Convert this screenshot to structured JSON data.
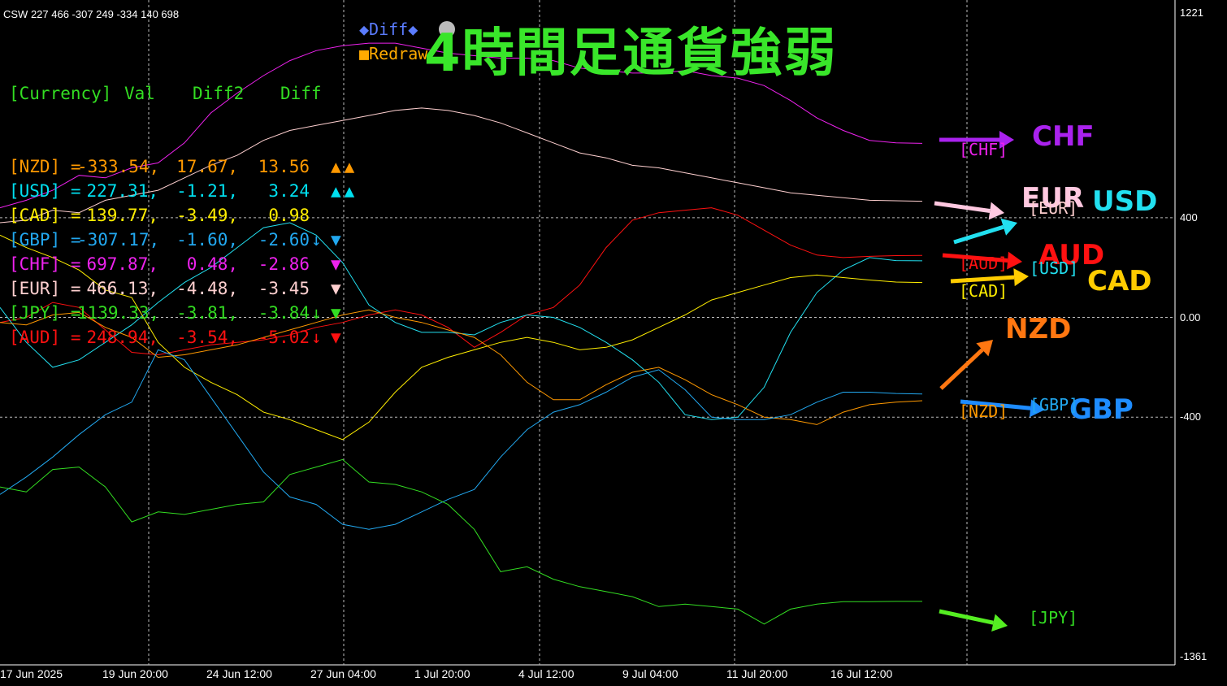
{
  "header": {
    "indicator_text": "CSW 227 466 -307 249 -334 140 698",
    "title": "4時間足通貨強弱",
    "diff_button": "◆Diff◆",
    "redraw_button": "■Redraw"
  },
  "table": {
    "headers": {
      "currency": "[Currency]",
      "val": "Val",
      "diff2": "Diff2",
      "diff": "Diff"
    },
    "rows": [
      {
        "name": "[NZD] =",
        "val": "-333.54,",
        "diff2": "17.67,",
        "diff": "13.56",
        "arrow": "",
        "marks": "▲▲",
        "color": "#ff9900"
      },
      {
        "name": "[USD] =",
        "val": "227.31,",
        "diff2": "-1.21,",
        "diff": "3.24",
        "arrow": "",
        "marks": "▲▲",
        "color": "#00e0f0"
      },
      {
        "name": "[CAD] =",
        "val": "139.77,",
        "diff2": "-3.49,",
        "diff": "0.98",
        "arrow": "",
        "marks": "",
        "color": "#ffee00"
      },
      {
        "name": "[GBP] =",
        "val": "-307.17,",
        "diff2": "-1.60,",
        "diff": "-2.60",
        "arrow": "↓",
        "marks": "▼",
        "color": "#22a8f0"
      },
      {
        "name": "[CHF] =",
        "val": "697.87,",
        "diff2": "0.48,",
        "diff": "-2.86",
        "arrow": "",
        "marks": "▼",
        "color": "#ee22ee"
      },
      {
        "name": "[EUR] =",
        "val": "466.13,",
        "diff2": "-4.48,",
        "diff": "-3.45",
        "arrow": "",
        "marks": "▼",
        "color": "#ffd0d0"
      },
      {
        "name": "[JPY] =",
        "val": "1139.33,",
        "diff2": "-3.81,",
        "diff": "-3.84",
        "arrow": "↓",
        "marks": "▼",
        "color": "#33dd22"
      },
      {
        "name": "[AUD] =",
        "val": "248.94,",
        "diff2": "-3.54,",
        "diff": "-5.02",
        "arrow": "↓",
        "marks": "▼",
        "color": "#ff1111"
      }
    ]
  },
  "labels": {
    "chf_big": "CHF",
    "eur_big": "EUR",
    "usd_big": "USD",
    "aud_big": "AUD",
    "cad_big": "CAD",
    "nzd_big": "NZD",
    "gbp_big": "GBP",
    "chf_tag": "[CHF]",
    "eur_tag": "[EUR]",
    "aud_tag": "[AUD]",
    "usd_tag": "[USD]",
    "cad_tag": "[CAD]",
    "nzd_tag": "[NZD]",
    "gbp_tag": "[GBP]",
    "jpy_tag": "[JPY]"
  },
  "colors": {
    "chf": "#aa22ee",
    "eur": "#ffc8e0",
    "usd": "#22e0f0",
    "aud": "#ff1111",
    "cad": "#ffcc00",
    "nzd": "#ff7711",
    "gbp": "#1e8cff",
    "jpy": "#55ee22",
    "title": "#39e62a"
  },
  "chart_data": {
    "type": "line",
    "ylim": [
      -1361,
      1221
    ],
    "y_ticks": [
      "1221",
      "400",
      "0.00",
      "-400",
      "-1361"
    ],
    "x_ticks": [
      "17 Jun 2025",
      "19 Jun 20:00",
      "24 Jun 12:00",
      "27 Jun 04:00",
      "1 Jul 20:00",
      "4 Jul 12:00",
      "9 Jul 04:00",
      "11 Jul 20:00",
      "16 Jul 12:00"
    ],
    "grid": true,
    "x": [
      0,
      1,
      2,
      3,
      4,
      5,
      6,
      7,
      8,
      9,
      10,
      11,
      12,
      13,
      14,
      15,
      16,
      17,
      18,
      19,
      20,
      21,
      22,
      23,
      24,
      25,
      26,
      27,
      28,
      29,
      30,
      31,
      32,
      33,
      34,
      35
    ],
    "series": [
      {
        "name": "CHF",
        "color": "#ee22ee",
        "values": [
          440,
          470,
          510,
          570,
          560,
          600,
          620,
          700,
          820,
          900,
          970,
          1030,
          1070,
          1090,
          1100,
          1100,
          1080,
          1060,
          1050,
          1040,
          1040,
          1030,
          1000,
          990,
          980,
          980,
          990,
          970,
          960,
          930,
          870,
          800,
          750,
          710,
          700,
          698
        ]
      },
      {
        "name": "EUR",
        "color": "#ffd0d0",
        "values": [
          380,
          390,
          430,
          420,
          470,
          490,
          510,
          560,
          610,
          650,
          710,
          750,
          770,
          790,
          810,
          830,
          840,
          830,
          810,
          780,
          740,
          700,
          660,
          640,
          610,
          600,
          580,
          560,
          540,
          520,
          500,
          490,
          480,
          470,
          468,
          466
        ]
      },
      {
        "name": "AUD",
        "color": "#ff1111",
        "values": [
          -20,
          0,
          60,
          40,
          -50,
          -140,
          -150,
          -130,
          -110,
          -100,
          -90,
          -70,
          -40,
          -20,
          10,
          30,
          10,
          -40,
          -120,
          -60,
          10,
          40,
          130,
          280,
          390,
          420,
          430,
          440,
          410,
          350,
          290,
          250,
          240,
          245,
          248,
          249
        ]
      },
      {
        "name": "USD",
        "color": "#22e0f0",
        "values": [
          40,
          -100,
          -200,
          -170,
          -100,
          -30,
          60,
          140,
          200,
          280,
          360,
          380,
          330,
          220,
          50,
          -20,
          -60,
          -60,
          -70,
          -20,
          10,
          0,
          -40,
          -100,
          -170,
          -260,
          -390,
          -410,
          -400,
          -280,
          -60,
          100,
          190,
          240,
          228,
          227
        ]
      },
      {
        "name": "CAD",
        "color": "#ffee00",
        "values": [
          330,
          280,
          240,
          190,
          110,
          80,
          -100,
          -200,
          -260,
          -310,
          -380,
          -410,
          -450,
          -490,
          -420,
          -300,
          -200,
          -160,
          -130,
          -100,
          -80,
          -100,
          -130,
          -120,
          -90,
          -40,
          10,
          70,
          100,
          130,
          160,
          170,
          160,
          150,
          142,
          140
        ]
      },
      {
        "name": "NZD",
        "color": "#ff9900",
        "values": [
          -20,
          -30,
          10,
          20,
          -40,
          -80,
          -160,
          -150,
          -130,
          -110,
          -80,
          -50,
          -20,
          10,
          30,
          0,
          -20,
          -50,
          -80,
          -150,
          -260,
          -330,
          -330,
          -270,
          -220,
          -200,
          -250,
          -310,
          -350,
          -400,
          -410,
          -430,
          -380,
          -350,
          -340,
          -334
        ]
      },
      {
        "name": "GBP",
        "color": "#22a8f0",
        "values": [
          -710,
          -640,
          -560,
          -470,
          -390,
          -340,
          -130,
          -170,
          -320,
          -470,
          -620,
          -720,
          -750,
          -830,
          -850,
          -830,
          -780,
          -730,
          -690,
          -560,
          -450,
          -380,
          -350,
          -300,
          -240,
          -210,
          -290,
          -400,
          -410,
          -410,
          -390,
          -340,
          -300,
          -300,
          -305,
          -307
        ]
      },
      {
        "name": "JPY",
        "color": "#33dd22",
        "values": [
          -680,
          -700,
          -610,
          -600,
          -680,
          -820,
          -780,
          -790,
          -770,
          -750,
          -740,
          -630,
          -600,
          -570,
          -660,
          -670,
          -700,
          -750,
          -850,
          -1020,
          -1000,
          -1050,
          -1080,
          -1100,
          -1120,
          -1160,
          -1150,
          -1160,
          -1170,
          -1230,
          -1170,
          -1150,
          -1140,
          -1140,
          -1139,
          -1139
        ]
      }
    ]
  }
}
